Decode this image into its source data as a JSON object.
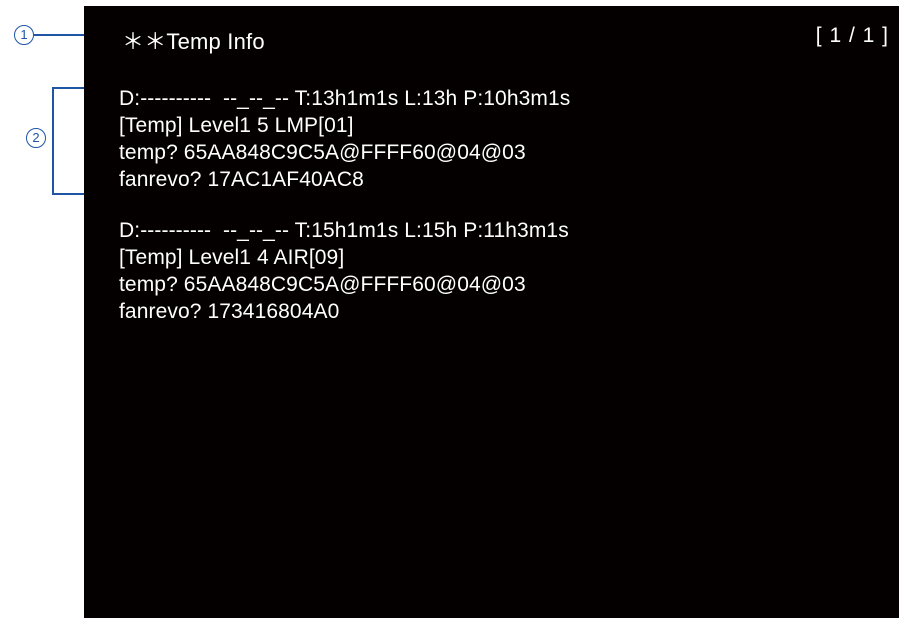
{
  "header": {
    "title": "＊＊Temp Info",
    "page_indicator": "[ 1 / 1 ]"
  },
  "callouts": [
    "1",
    "2"
  ],
  "entries": [
    {
      "lines": [
        "D:----------  --_--_-- T:13h1m1s L:13h P:10h3m1s",
        "[Temp] Level1 5 LMP[01]",
        "temp? 65AA848C9C5A@FFFF60@04@03",
        "fanrevo? 17AC1AF40AC8"
      ]
    },
    {
      "lines": [
        "D:----------  --_--_-- T:15h1m1s L:15h P:11h3m1s",
        "[Temp] Level1 4 AIR[09]",
        "temp? 65AA848C9C5A@FFFF60@04@03",
        "fanrevo? 173416804A0"
      ]
    }
  ],
  "colors": {
    "screen_bg": "#050000",
    "text": "#ffffff",
    "callout": "#1f55a5"
  }
}
